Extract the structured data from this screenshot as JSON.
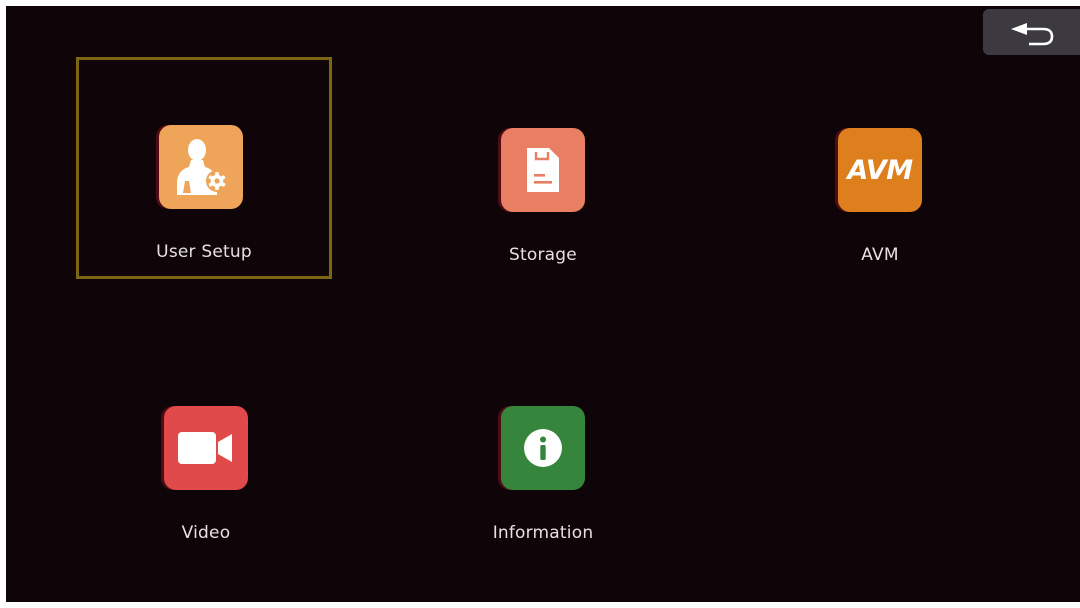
{
  "back_button": {
    "icon": "back-arrow-icon"
  },
  "menu": {
    "selected": "User Setup",
    "items": [
      {
        "label": "User Setup",
        "icon": "user-settings-icon",
        "color": "#eea55a"
      },
      {
        "label": "Storage",
        "icon": "document-icon",
        "color": "#e87e62"
      },
      {
        "label": "AVM",
        "icon": "avm-icon",
        "icon_text": "AVM",
        "color": "#de7f1e"
      },
      {
        "label": "Video",
        "icon": "video-camera-icon",
        "color": "#e14a4a"
      },
      {
        "label": "Information",
        "icon": "info-icon",
        "color": "#35853c"
      }
    ]
  },
  "colors": {
    "background": "#0f0509",
    "selection_border": "#7d6612",
    "label_text": "#e6e2e2"
  }
}
